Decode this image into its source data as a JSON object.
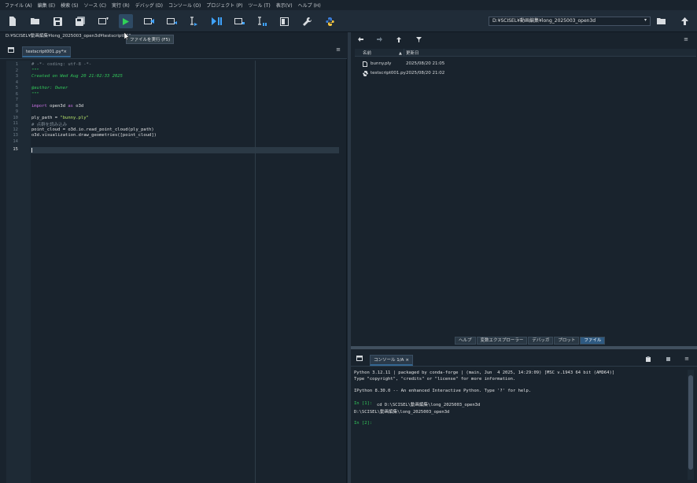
{
  "menu": [
    "ファイル (A)",
    "編集 (E)",
    "検索 (S)",
    "ソース (C)",
    "実行 (R)",
    "デバッグ (D)",
    "コンソール (O)",
    "プロジェクト (P)",
    "ツール (T)",
    "表示(V)",
    "ヘルプ (H)"
  ],
  "toolbar": {
    "working_dir": "D:¥SCISEL¥動画編集¥long_2025003_open3d",
    "tooltip": "ファイルを実行 (F5)"
  },
  "editor": {
    "path": "D:¥SCISEL¥動画編集¥long_2025003_open3d¥testscript001.py",
    "tab_label": "testscript001.py*",
    "current_line": "15",
    "line_numbers": [
      "1",
      "2",
      "3",
      "4",
      "5",
      "6",
      "7",
      "8",
      "9",
      "10",
      "11",
      "12",
      "13",
      "14",
      "15"
    ],
    "code": {
      "l1": "# -*- coding: utf-8 -*-",
      "l2": "\"\"\"",
      "l3": "Created on Wed Aug 20 21:02:33 2025",
      "l5": "@author: Owner",
      "l6": "\"\"\"",
      "l8_kw1": "import",
      "l8_mod": " open3d ",
      "l8_kw2": "as",
      "l8_alias": " o3d",
      "l10_a": "ply_path = ",
      "l10_str": "\"bunny.ply\"",
      "l11": "# 点群を読み込み",
      "l12": "point_cloud = o3d.io.read_point_cloud(ply_path)",
      "l13": "o3d.visualization.draw_geometries([point_cloud])"
    }
  },
  "files": {
    "col_name": "名前",
    "col_modified": "更新日",
    "rows": [
      {
        "name": "bunny.ply",
        "date": "2025/08/20 21:05"
      },
      {
        "name": "testscript001.py",
        "date": "2025/08/20 21:02"
      }
    ]
  },
  "pane_tabs": [
    "ヘルプ",
    "変数エクスプローラー",
    "デバッガ",
    "プロット",
    "ファイル"
  ],
  "console": {
    "tab_label": "コンソール 1/A",
    "lines": [
      "Python 3.12.11 | packaged by conda-forge | (main, Jun  4 2025, 14:29:09) [MSC v.1943 64 bit (AMD64)]",
      "Type \"copyright\", \"credits\" or \"license\" for more information.",
      "",
      "IPython 8.30.0 -- An enhanced Interactive Python. Type '?' for help.",
      "",
      "cd D:\\SCISEL\\動画編集\\long_2025003_open3d",
      "D:\\SCISEL\\動画編集\\long_2025003_open3d",
      ""
    ],
    "prompt1": "In [1]:",
    "prompt2": "In [2]:"
  },
  "colors": {
    "background": "#19232d",
    "accent": "#346792",
    "prompt_green": "#32c75a",
    "docstring_green": "#32c75a",
    "keyword_purple": "#c670e0",
    "string_yellowgreen": "#b6e36a"
  }
}
